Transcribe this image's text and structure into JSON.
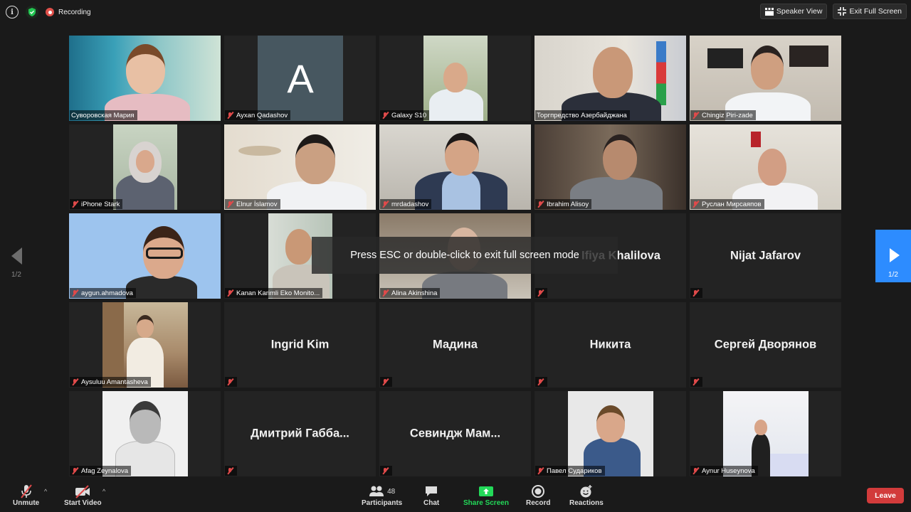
{
  "topbar": {
    "recording_label": "Recording",
    "speaker_view_label": "Speaker View",
    "exit_full_screen_label": "Exit Full Screen"
  },
  "toast": "Press ESC or double-click to exit full screen mode",
  "pager": {
    "left": "1/2",
    "right": "1/2"
  },
  "tiles": [
    {
      "name": "Суворовская Мария",
      "muted": false,
      "type": "video"
    },
    {
      "name": "Ayxan Qadashov",
      "muted": true,
      "type": "avatar",
      "avatar_letter": "A"
    },
    {
      "name": "Galaxy S10",
      "muted": true,
      "type": "video"
    },
    {
      "name": "Торгпредство Азербайджана",
      "muted": false,
      "type": "video",
      "active": true
    },
    {
      "name": "Chingiz Piri-zade",
      "muted": true,
      "type": "video"
    },
    {
      "name": "iPhone Stark",
      "muted": true,
      "type": "video"
    },
    {
      "name": "Elnur İslamov",
      "muted": true,
      "type": "video"
    },
    {
      "name": "mrdadashov",
      "muted": true,
      "type": "video"
    },
    {
      "name": "Ibrahim Alisoy",
      "muted": true,
      "type": "video"
    },
    {
      "name": "Руслан Мирсаяпов",
      "muted": true,
      "type": "video"
    },
    {
      "name": "aygun.ahmadova",
      "muted": true,
      "type": "video"
    },
    {
      "name": "Kanan Karimli Eko Monito...",
      "muted": true,
      "type": "video"
    },
    {
      "name": "Alina Akinshina",
      "muted": true,
      "type": "video"
    },
    {
      "name": "Ifiya Khalilova",
      "muted": true,
      "type": "name"
    },
    {
      "name": "Nijat Jafarov",
      "muted": true,
      "type": "name"
    },
    {
      "name": "Aysuluu Amantasheva",
      "muted": true,
      "type": "video"
    },
    {
      "name": "Ingrid Kim",
      "muted": true,
      "type": "name"
    },
    {
      "name": "Мадина",
      "muted": true,
      "type": "name"
    },
    {
      "name": "Никита",
      "muted": true,
      "type": "name"
    },
    {
      "name": "Сергей Дворянов",
      "muted": true,
      "type": "name"
    },
    {
      "name": "Afag Zeynalova",
      "muted": true,
      "type": "video"
    },
    {
      "name": "Дмитрий Габба...",
      "muted": true,
      "type": "name"
    },
    {
      "name": "Севиндж Мам...",
      "muted": true,
      "type": "name"
    },
    {
      "name": "Павел Судариков",
      "muted": true,
      "type": "video"
    },
    {
      "name": "Aynur Huseynova",
      "muted": true,
      "type": "video"
    }
  ],
  "bottombar": {
    "unmute": "Unmute",
    "start_video": "Start Video",
    "participants": "Participants",
    "participants_count": "48",
    "chat": "Chat",
    "share_screen": "Share Screen",
    "record": "Record",
    "reactions": "Reactions",
    "leave": "Leave"
  },
  "colors": {
    "accent_blue": "#2d8cff",
    "share_green": "#23d959",
    "leave_red": "#d23b3b",
    "active_speaker": "#b6d04a"
  }
}
